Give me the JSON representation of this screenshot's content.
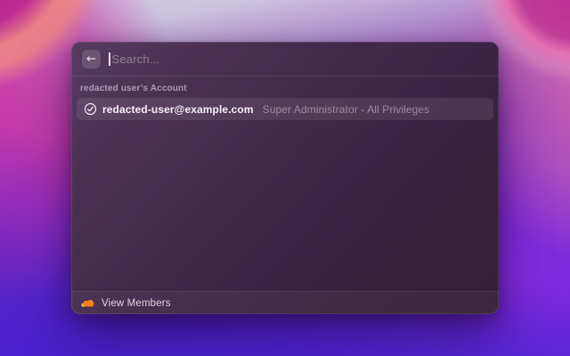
{
  "window": {
    "search": {
      "placeholder": "Search...",
      "value": ""
    },
    "section_header": "redacted user’s Account",
    "account": {
      "email": "redacted-user@example.com",
      "role": "Super Administrator - All Privileges"
    },
    "footer": {
      "view_members": "View Members"
    }
  },
  "icons": {
    "back": "←",
    "account_status": "check-circle",
    "footer_brand": "cloudflare-cloud"
  },
  "colors": {
    "cloud_orange": "#f6821f",
    "cloud_orange_light": "#fbad41",
    "window_top": "#573a60",
    "window_bottom": "#332035",
    "row_highlight": "rgba(255,255,255,0.085)"
  }
}
